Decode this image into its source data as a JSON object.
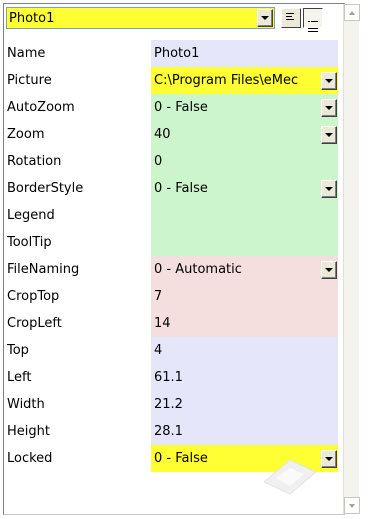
{
  "selector": {
    "value": "Photo1"
  },
  "toolbar": {
    "sort_alpha_icon": "lines-left-icon",
    "sort_cat_icon": "lines-list-icon"
  },
  "colors": {
    "selector_bg": "#ffff33",
    "lavender": "#e6e6fa",
    "green": "#ccf5cc",
    "pink": "#f5dede",
    "yellow": "#ffff33"
  },
  "properties": [
    {
      "name": "Name",
      "value": "Photo1",
      "color": "#e6e6fa",
      "dropdown": false
    },
    {
      "name": "Picture",
      "value": "C:\\Program Files\\eMec",
      "color": "#ffff33",
      "dropdown": true
    },
    {
      "name": "AutoZoom",
      "value": "0 - False",
      "color": "#ccf5cc",
      "dropdown": true
    },
    {
      "name": "Zoom",
      "value": "40",
      "color": "#ccf5cc",
      "dropdown": true
    },
    {
      "name": "Rotation",
      "value": "0",
      "color": "#ccf5cc",
      "dropdown": false
    },
    {
      "name": "BorderStyle",
      "value": "0 - False",
      "color": "#ccf5cc",
      "dropdown": true
    },
    {
      "name": "Legend",
      "value": "",
      "color": "#ccf5cc",
      "dropdown": false
    },
    {
      "name": "ToolTip",
      "value": "",
      "color": "#ccf5cc",
      "dropdown": false
    },
    {
      "name": "FileNaming",
      "value": "0 - Automatic",
      "color": "#f5dede",
      "dropdown": true
    },
    {
      "name": "CropTop",
      "value": "7",
      "color": "#f5dede",
      "dropdown": false
    },
    {
      "name": "CropLeft",
      "value": "14",
      "color": "#f5dede",
      "dropdown": false
    },
    {
      "name": "Top",
      "value": "4",
      "color": "#e6e6fa",
      "dropdown": false
    },
    {
      "name": "Left",
      "value": "61.1",
      "color": "#e6e6fa",
      "dropdown": false
    },
    {
      "name": "Width",
      "value": "21.2",
      "color": "#e6e6fa",
      "dropdown": false
    },
    {
      "name": "Height",
      "value": "28.1",
      "color": "#e6e6fa",
      "dropdown": false
    },
    {
      "name": "Locked",
      "value": "0 - False",
      "color": "#ffff33",
      "dropdown": true
    }
  ]
}
